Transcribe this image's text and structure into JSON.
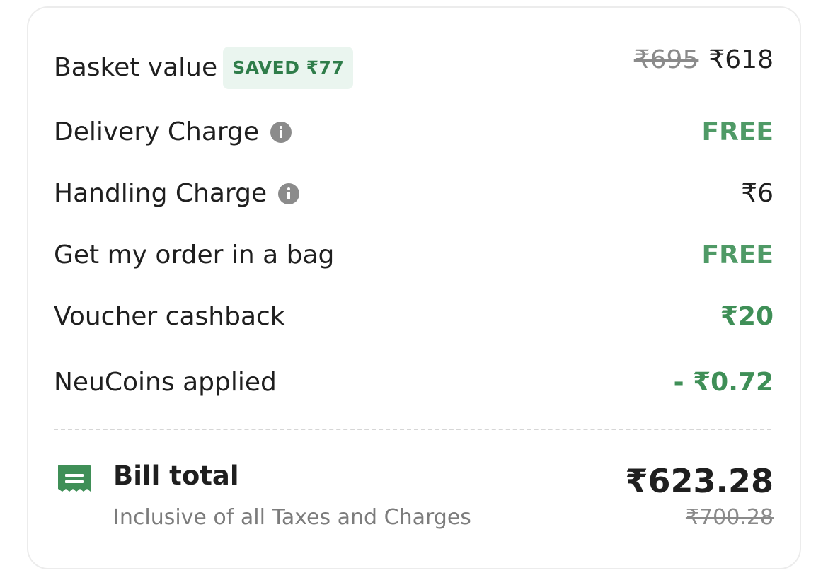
{
  "basket": {
    "label": "Basket value",
    "saved_badge": "SAVED ₹77",
    "original_price": "₹695",
    "price": "₹618"
  },
  "delivery": {
    "label": "Delivery Charge",
    "value": "FREE"
  },
  "handling": {
    "label": "Handling Charge",
    "value": "₹6"
  },
  "bag": {
    "label": "Get my order in a bag",
    "value": "FREE"
  },
  "voucher": {
    "label": "Voucher cashback",
    "value": "₹20"
  },
  "neucoins": {
    "label": "NeuCoins applied",
    "value": "- ₹0.72"
  },
  "bill": {
    "title": "Bill total",
    "subtitle": "Inclusive of all Taxes and Charges",
    "total": "₹623.28",
    "original_total": "₹700.28"
  },
  "colors": {
    "accent_green": "#3f8f57",
    "badge_bg": "#eaf5ef",
    "muted_text": "#7c7c7c"
  },
  "icons": {
    "info": "info-icon",
    "bill": "receipt-icon"
  }
}
